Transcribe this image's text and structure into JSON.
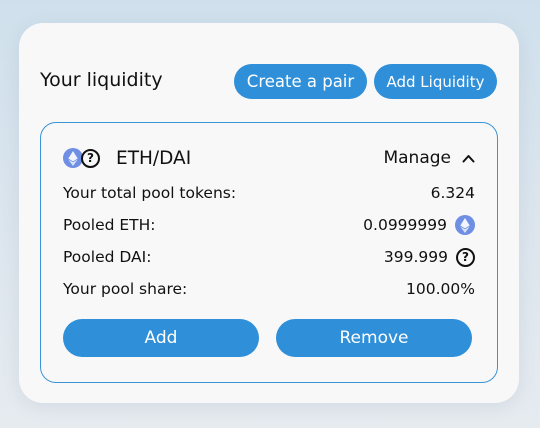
{
  "header": {
    "title": "Your liquidity",
    "create_pair_label": "Create a pair",
    "add_liquidity_label": "Add Liquidity"
  },
  "pool": {
    "pair": "ETH/DAI",
    "manage_label": "Manage",
    "rows": [
      {
        "label": "Your total pool tokens:",
        "value": "6.324"
      },
      {
        "label": "Pooled ETH:",
        "value": "0.0999999",
        "icon": "eth-icon"
      },
      {
        "label": "Pooled DAI:",
        "value": "399.999",
        "icon": "question-icon"
      },
      {
        "label": "Your pool share:",
        "value": "100.00%"
      }
    ],
    "add_label": "Add",
    "remove_label": "Remove",
    "question_glyph": "?"
  },
  "colors": {
    "accent": "#2f8fd8",
    "border": "#3a94d6",
    "eth": "#6e8fe4"
  }
}
